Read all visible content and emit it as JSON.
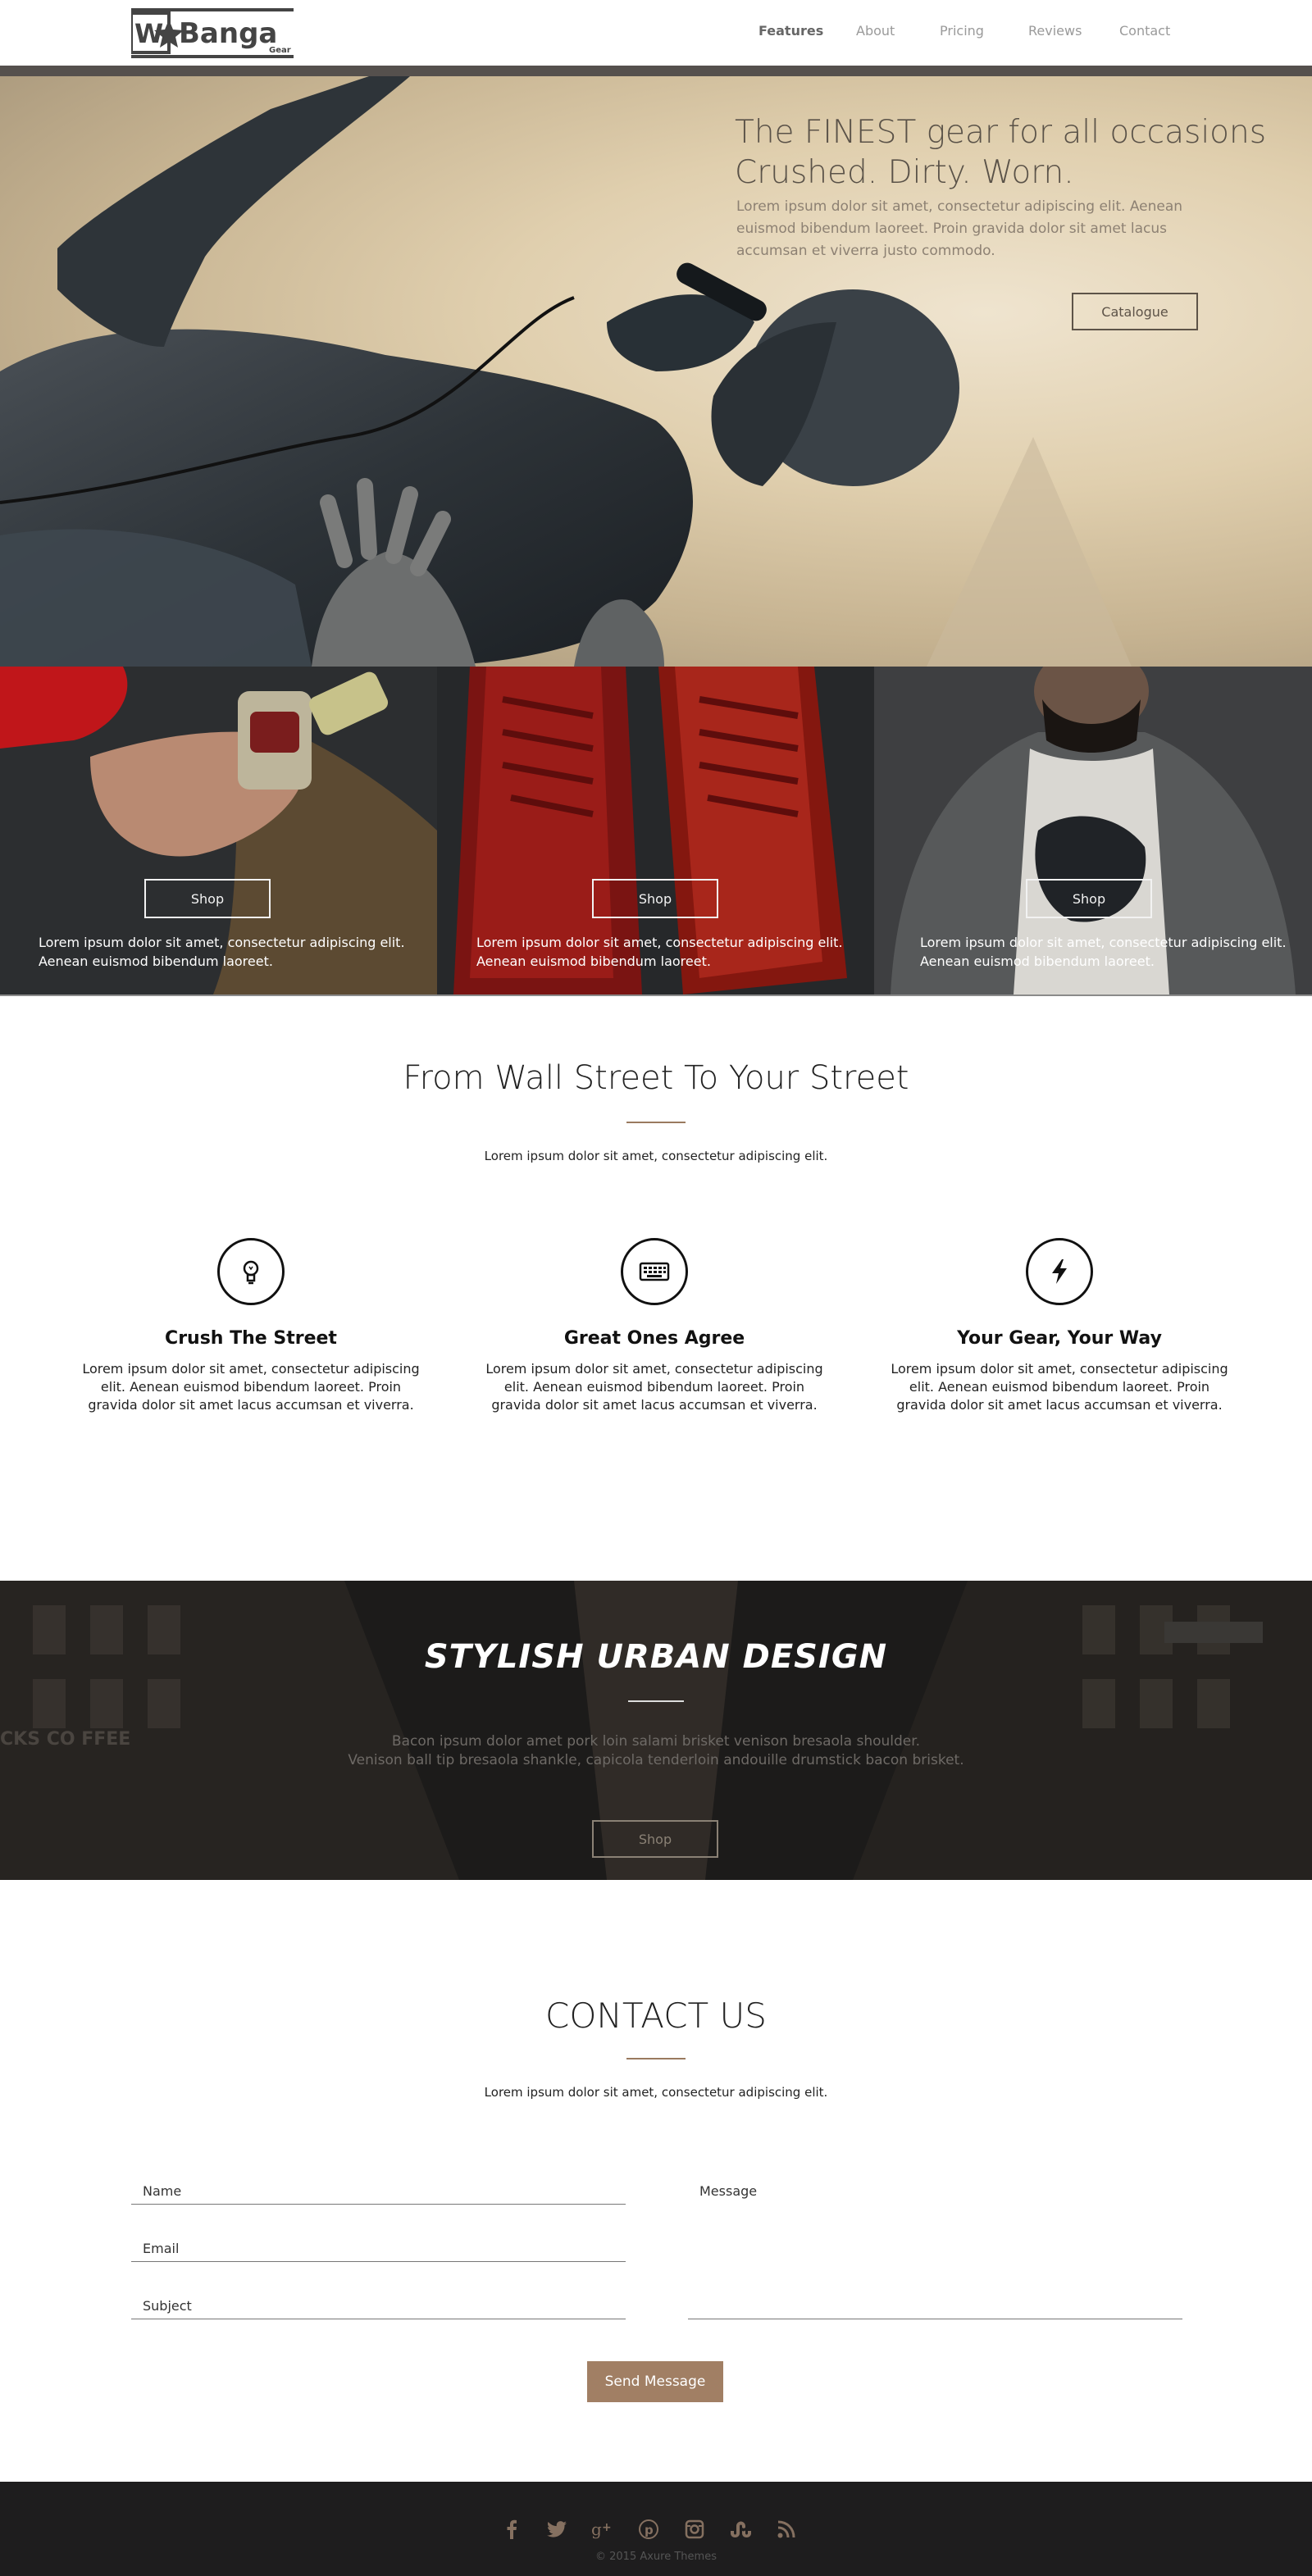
{
  "brand": {
    "logo_text": "Banga",
    "logo_sub": "Gear"
  },
  "nav": {
    "items": [
      {
        "label": "Features",
        "active": true
      },
      {
        "label": "About",
        "active": false
      },
      {
        "label": "Pricing",
        "active": false
      },
      {
        "label": "Reviews",
        "active": false
      },
      {
        "label": "Contact",
        "active": false
      }
    ]
  },
  "hero": {
    "title_line1": "The FINEST gear for all occasions",
    "title_line2": "Crushed. Dirty. Worn.",
    "text": "Lorem ipsum dolor sit amet, consectetur adipiscing elit. Aenean euismod bibendum laoreet. Proin gravida dolor sit amet lacus accumsan et viverra justo commodo.",
    "button": "Catalogue"
  },
  "tiles": [
    {
      "button": "Shop",
      "text": "Lorem ipsum dolor sit amet, consectetur adipiscing elit. Aenean euismod bibendum laoreet."
    },
    {
      "button": "Shop",
      "text": "Lorem ipsum dolor sit amet, consectetur adipiscing elit. Aenean euismod bibendum laoreet."
    },
    {
      "button": "Shop",
      "text": "Lorem ipsum dolor sit amet, consectetur adipiscing elit. Aenean euismod bibendum laoreet."
    }
  ],
  "features": {
    "title": "From Wall Street To Your Street",
    "subtitle": "Lorem ipsum dolor sit amet, consectetur adipiscing elit.",
    "items": [
      {
        "icon": "lightbulb-icon",
        "title": "Crush The Street",
        "text": "Lorem ipsum dolor sit amet, consectetur adipiscing elit. Aenean euismod bibendum laoreet. Proin gravida dolor sit amet lacus accumsan et viverra."
      },
      {
        "icon": "keyboard-icon",
        "title": "Great Ones Agree",
        "text": "Lorem ipsum dolor sit amet, consectetur adipiscing elit. Aenean euismod bibendum laoreet. Proin gravida dolor sit amet lacus accumsan et viverra."
      },
      {
        "icon": "lightning-icon",
        "title": "Your Gear, Your Way",
        "text": "Lorem ipsum dolor sit amet, consectetur adipiscing elit. Aenean euismod bibendum laoreet. Proin gravida dolor sit amet lacus accumsan et viverra."
      }
    ]
  },
  "urban": {
    "title": "STYLISH URBAN DESIGN",
    "text_line1": "Bacon ipsum dolor amet pork loin salami brisket venison bresaola shoulder.",
    "text_line2": "Venison ball tip bresaola shankle, capicola tenderloin andouille drumstick bacon brisket.",
    "button": "Shop",
    "sign_text": "CKS CO FFEE"
  },
  "contact": {
    "title": "CONTACT US",
    "subtitle": "Lorem ipsum dolor sit amet, consectetur adipiscing elit.",
    "name_label": "Name",
    "email_label": "Email",
    "subject_label": "Subject",
    "message_label": "Message",
    "button": "Send Message"
  },
  "footer": {
    "social": [
      "facebook-icon",
      "twitter-icon",
      "google-plus-icon",
      "pinterest-icon",
      "instagram-icon",
      "stumbleupon-icon",
      "rss-icon"
    ],
    "copyright": "© 2015 Axure Themes"
  },
  "colors": {
    "accent": "#a17f64",
    "header_bar": "#55504d",
    "footer_bg": "#1e1d1e",
    "urban_bg": "#1b1a1a"
  }
}
